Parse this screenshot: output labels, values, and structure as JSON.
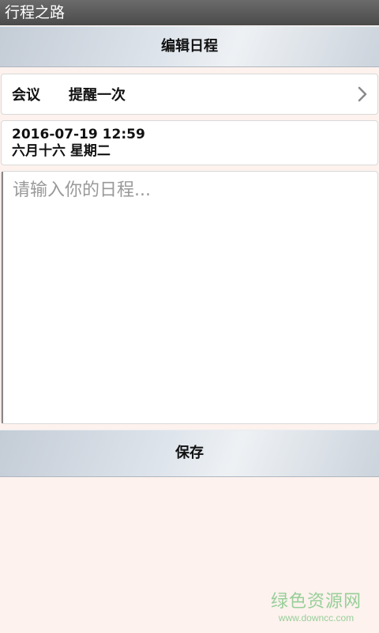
{
  "app": {
    "title": "行程之路"
  },
  "header": {
    "title": "编辑日程"
  },
  "reminder": {
    "type": "会议",
    "frequency": "提醒一次",
    "chevron_icon": "chevron-right-icon"
  },
  "datetime": {
    "date_time": "2016-07-19 12:59",
    "lunar": "六月十六 星期二"
  },
  "schedule_input": {
    "value": "",
    "placeholder": "请输入你的日程..."
  },
  "actions": {
    "save_label": "保存"
  },
  "watermark": {
    "title": "绿色资源网",
    "url": "www.downcc.com"
  },
  "colors": {
    "app_bar": "#575757",
    "page_background": "#fdf2ee",
    "bar_gradient_light": "#eef1f4",
    "bar_gradient_dark": "#c4ccd6",
    "watermark": "#86c98a"
  }
}
